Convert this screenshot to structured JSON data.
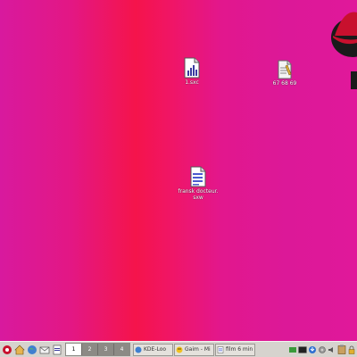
{
  "desktop": {
    "icons": [
      {
        "name": "1.sxc",
        "type": "spreadsheet"
      },
      {
        "name": "67 68 69",
        "type": "text"
      },
      {
        "name": "fransk docteur.\nsxw",
        "type": "writer"
      }
    ]
  },
  "panel": {
    "pager": [
      "1",
      "2",
      "3",
      "4"
    ],
    "active_desktop": "1",
    "tasks": [
      {
        "label": "KDE-Loo",
        "icon": "konqueror-icon"
      },
      {
        "label": "Gaim - Mi",
        "icon": "gaim-icon"
      },
      {
        "label": "film 6 min",
        "icon": "document-icon"
      }
    ]
  },
  "colors": {
    "desktop_magenta": "#d8199e",
    "desktop_red": "#f5144b",
    "panel_bg": "#d6d3ce"
  }
}
